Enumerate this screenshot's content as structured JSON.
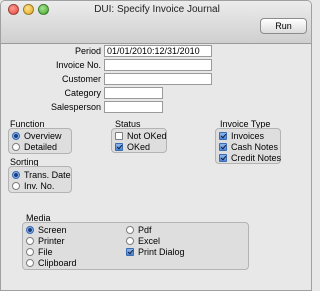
{
  "window": {
    "title": "DUI: Specify Invoice Journal"
  },
  "toolbar": {
    "run_label": "Run"
  },
  "fields": {
    "period": {
      "label": "Period",
      "value": "01/01/2010:12/31/2010"
    },
    "invoice_no": {
      "label": "Invoice No.",
      "value": ""
    },
    "customer": {
      "label": "Customer",
      "value": ""
    },
    "category": {
      "label": "Category",
      "value": ""
    },
    "salesperson": {
      "label": "Salesperson",
      "value": ""
    }
  },
  "function": {
    "title": "Function",
    "options": [
      {
        "label": "Overview",
        "selected": true
      },
      {
        "label": "Detailed",
        "selected": false
      }
    ]
  },
  "status": {
    "title": "Status",
    "options": [
      {
        "label": "Not OKed",
        "checked": false
      },
      {
        "label": "OKed",
        "checked": true
      }
    ]
  },
  "invoice_type": {
    "title": "Invoice Type",
    "options": [
      {
        "label": "Invoices",
        "checked": true
      },
      {
        "label": "Cash Notes",
        "checked": true
      },
      {
        "label": "Credit Notes",
        "checked": true
      }
    ]
  },
  "sorting": {
    "title": "Sorting",
    "options": [
      {
        "label": "Trans. Date",
        "selected": true
      },
      {
        "label": "Inv. No.",
        "selected": false
      }
    ]
  },
  "media": {
    "title": "Media",
    "left": [
      {
        "label": "Screen",
        "selected": true
      },
      {
        "label": "Printer",
        "selected": false
      },
      {
        "label": "File",
        "selected": false
      },
      {
        "label": "Clipboard",
        "selected": false
      }
    ],
    "right": [
      {
        "label": "Pdf",
        "selected": false,
        "kind": "radio"
      },
      {
        "label": "Excel",
        "selected": false,
        "kind": "radio"
      },
      {
        "label": "Print Dialog",
        "selected": true,
        "kind": "check"
      }
    ]
  }
}
